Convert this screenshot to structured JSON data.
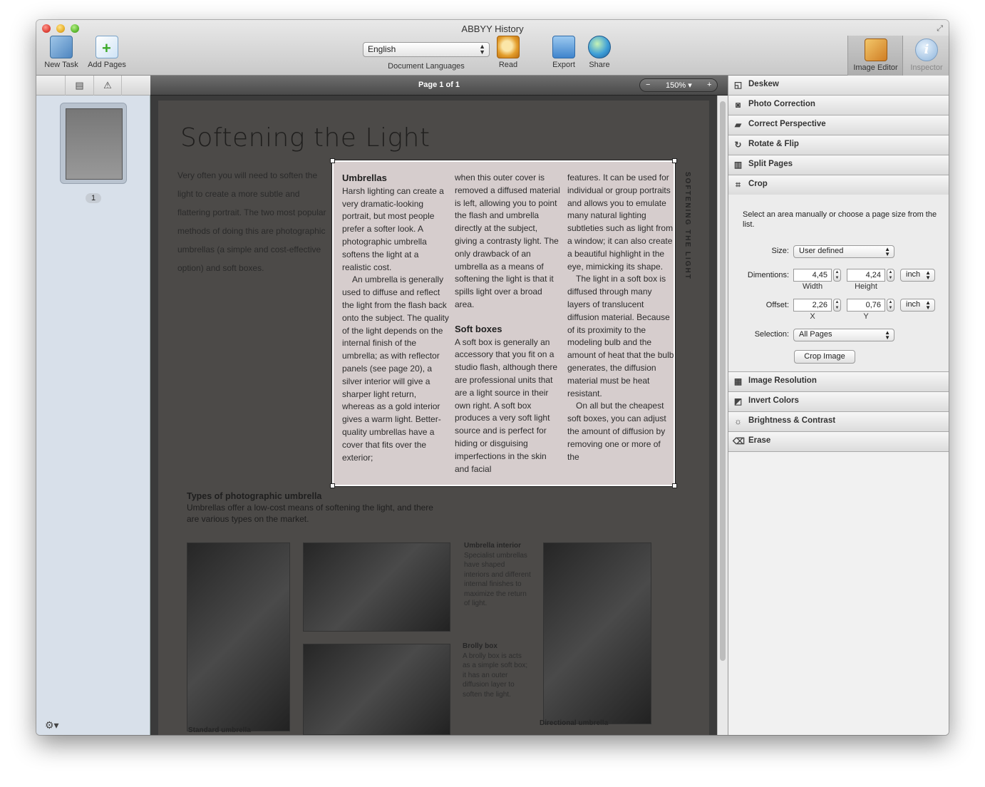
{
  "window": {
    "title": "ABBYY History"
  },
  "toolbar": {
    "new_task": "New Task",
    "add_pages": "Add Pages",
    "language": "English",
    "document_languages": "Document Languages",
    "read": "Read",
    "export": "Export",
    "share": "Share",
    "image_editor": "Image Editor",
    "inspector": "Inspector"
  },
  "left_panel": {
    "page_number": "1"
  },
  "page_bar": {
    "page_label": "Page 1 of 1",
    "zoom_minus": "−",
    "zoom_value": "150% ▾",
    "zoom_plus": "+"
  },
  "document": {
    "title": "Softening the Light",
    "intro": "Very often you will need to soften the light to create a more subtle and flattering portrait. The two most popular methods of doing this are photographic umbrellas (a simple and cost-effective option) and soft boxes.",
    "side_title": "SOFTENING THE LIGHT",
    "col1_heading": "Umbrellas",
    "col1_text": "Harsh lighting can create a very dramatic-looking portrait, but most people prefer a softer look. A photographic umbrella softens the light at a realistic cost.",
    "col1_text2": "An umbrella is generally used to diffuse and reflect the light from the flash back onto the subject. The quality of the light depends on the internal finish of the umbrella; as with reflector panels (see page 20), a silver interior will give a sharper light return, whereas as a gold interior gives a warm light. Better-quality umbrellas have a cover that fits over the exterior;",
    "col2_text": "when this outer cover is removed a diffused material is left, allowing you to point the flash and umbrella directly at the subject, giving a contrasty light. The only drawback of an umbrella as a means of softening the light is that it spills light over a broad area.",
    "col2_heading": "Soft boxes",
    "col2_text2": "A soft box is generally an accessory that you fit on a studio flash, although there are professional units that are a light source in their own right. A soft box produces a very soft light source and is perfect for hiding or disguising imperfections in the skin and facial",
    "col3_text": "features. It can be used for individual or group portraits and allows you to emulate many natural lighting subtleties such as light from a window; it can also create a beautiful highlight in the eye, mimicking its shape.",
    "col3_text2": "The light in a soft box is diffused through many layers of translucent diffusion material. Because of its proximity to the modeling bulb and the amount of heat that the bulb generates, the diffusion material must be heat resistant.",
    "col3_text3": "On all but the cheapest soft boxes, you can adjust the amount of diffusion by removing one or more of the",
    "types_heading": "Types of photographic umbrella",
    "types_text": "Umbrellas offer a low-cost means of softening the light, and there are various types on the market.",
    "umbrella_interior_heading": "Umbrella interior",
    "umbrella_interior_text": "Specialist umbrellas have shaped interiors and different internal finishes to maximize the return of light.",
    "brolly_heading": "Brolly box",
    "brolly_text": "A brolly box is acts as a simple soft box; it has an outer diffusion layer to soften the light.",
    "standard_caption": "Standard umbrella",
    "directional_caption": "Directional umbrella"
  },
  "right_panel": {
    "sections_top": [
      "Deskew",
      "Photo Correction",
      "Correct Perspective",
      "Rotate & Flip",
      "Split Pages",
      "Crop"
    ],
    "sections_bottom": [
      "Image Resolution",
      "Invert Colors",
      "Brightness & Contrast",
      "Erase"
    ],
    "crop": {
      "help": "Select an area manually or choose a page size from the list.",
      "size_label": "Size:",
      "size_value": "User defined",
      "dimensions_label": "Dimentions:",
      "width_value": "4,45",
      "width_label": "Width",
      "height_value": "4,24",
      "height_label": "Height",
      "dim_unit": "inch",
      "offset_label": "Offset:",
      "x_value": "2,26",
      "x_label": "X",
      "y_value": "0,76",
      "y_label": "Y",
      "offset_unit": "inch",
      "selection_label": "Selection:",
      "selection_value": "All Pages",
      "crop_button": "Crop Image"
    }
  }
}
